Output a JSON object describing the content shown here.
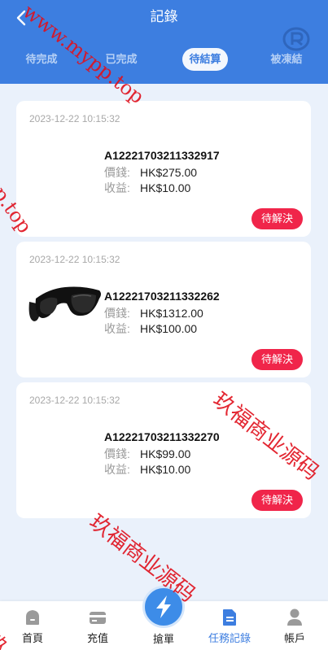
{
  "header": {
    "title": "記錄",
    "tabs": [
      "待完成",
      "已完成",
      "待結算",
      "被凍結"
    ]
  },
  "orders": [
    {
      "time": "2023-12-22 10:15:32",
      "order_id": "A12221703211332917",
      "price_label": "價錢:",
      "price": "HK$275.00",
      "income_label": "收益:",
      "income": "HK$10.00",
      "status": "待解決",
      "has_image": false
    },
    {
      "time": "2023-12-22 10:15:32",
      "order_id": "A12221703211332262",
      "price_label": "價錢:",
      "price": "HK$1312.00",
      "income_label": "收益:",
      "income": "HK$100.00",
      "status": "待解決",
      "has_image": true,
      "image_icon": "sunglasses-icon"
    },
    {
      "time": "2023-12-22 10:15:32",
      "order_id": "A12221703211332270",
      "price_label": "價錢:",
      "price": "HK$99.00",
      "income_label": "收益:",
      "income": "HK$10.00",
      "status": "待解決",
      "has_image": false
    }
  ],
  "nav": {
    "items": [
      {
        "label": "首頁",
        "icon": "home-icon"
      },
      {
        "label": "充值",
        "icon": "card-icon"
      },
      {
        "label": "搶單",
        "icon": "lightning-icon"
      },
      {
        "label": "任務記錄",
        "icon": "document-icon"
      },
      {
        "label": "帳戶",
        "icon": "user-icon"
      }
    ]
  },
  "watermarks": {
    "url_text": "www.mypp.top",
    "url_text_2": "pp.top",
    "cn_text": "玖福商业源码",
    "cn_text_2": "玖福商业源码",
    "cn_text_3": "玖"
  },
  "colors": {
    "primary": "#3d7ee0",
    "status_red": "#f0254a",
    "watermark_red": "#e0101c"
  }
}
